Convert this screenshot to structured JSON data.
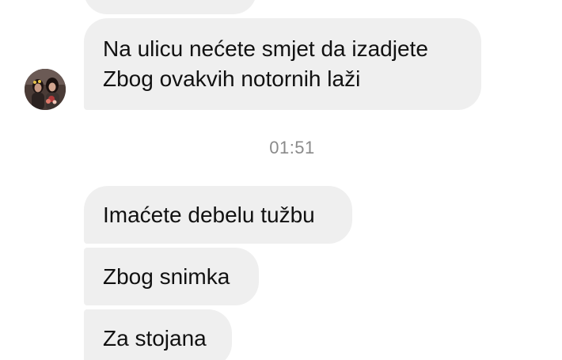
{
  "messages": [
    {
      "lines": [
        "Na ulicu nećete smjet da izadjete",
        "Zbog ovakvih notornih laži"
      ]
    },
    {
      "lines": [
        "Imaćete debelu tužbu"
      ]
    },
    {
      "lines": [
        "Zbog snimka"
      ]
    },
    {
      "lines": [
        "Za stojana"
      ]
    }
  ],
  "timestamp": "01:51",
  "avatar_icon": "profile-photo-icon",
  "colors": {
    "bubble_bg": "#efefef",
    "text": "#111111",
    "timestamp": "#8a8a8a"
  }
}
